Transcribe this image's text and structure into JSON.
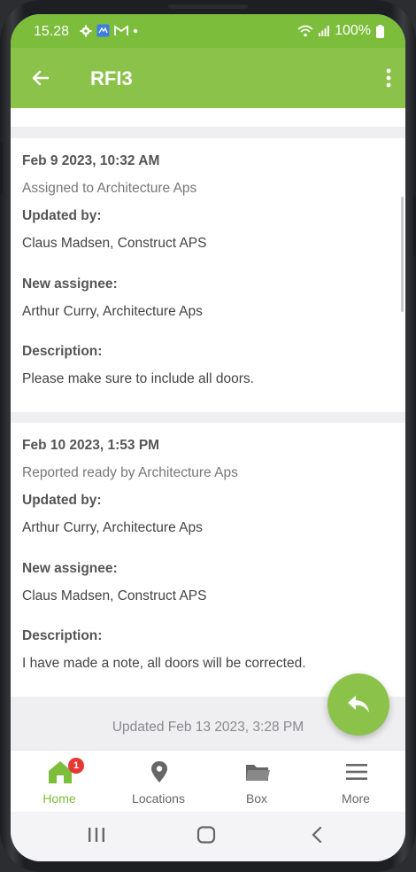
{
  "status_bar": {
    "time": "15.28",
    "battery": "100%"
  },
  "app_bar": {
    "title": "RFI3"
  },
  "entries": [
    {
      "timestamp": "Feb 9 2023, 10:32 AM",
      "action": "Assigned to Architecture Aps",
      "updated_by_label": "Updated by:",
      "updated_by": "Claus Madsen, Construct APS",
      "new_assignee_label": "New assignee:",
      "new_assignee": "Arthur Curry, Architecture Aps",
      "description_label": "Description:",
      "description": "Please make sure to include all doors."
    },
    {
      "timestamp": "Feb 10 2023, 1:53 PM",
      "action": "Reported ready by Architecture Aps",
      "updated_by_label": "Updated by:",
      "updated_by": "Arthur Curry, Architecture Aps",
      "new_assignee_label": "New assignee:",
      "new_assignee": "Claus Madsen, Construct APS",
      "description_label": "Description:",
      "description": "I have made a note, all doors will be corrected."
    }
  ],
  "footer": {
    "updated": "Updated Feb 13 2023, 3:28 PM"
  },
  "bottom_nav": {
    "items": [
      {
        "label": "Home",
        "icon": "home-icon",
        "badge": "1",
        "active": true
      },
      {
        "label": "Locations",
        "icon": "location-pin-icon"
      },
      {
        "label": "Box",
        "icon": "folder-icon"
      },
      {
        "label": "More",
        "icon": "hamburger-icon"
      }
    ]
  },
  "colors": {
    "status_bar": "#7cbd3b",
    "app_bar": "#8bc34a",
    "accent": "#8bc34a",
    "badge": "#e53935"
  }
}
